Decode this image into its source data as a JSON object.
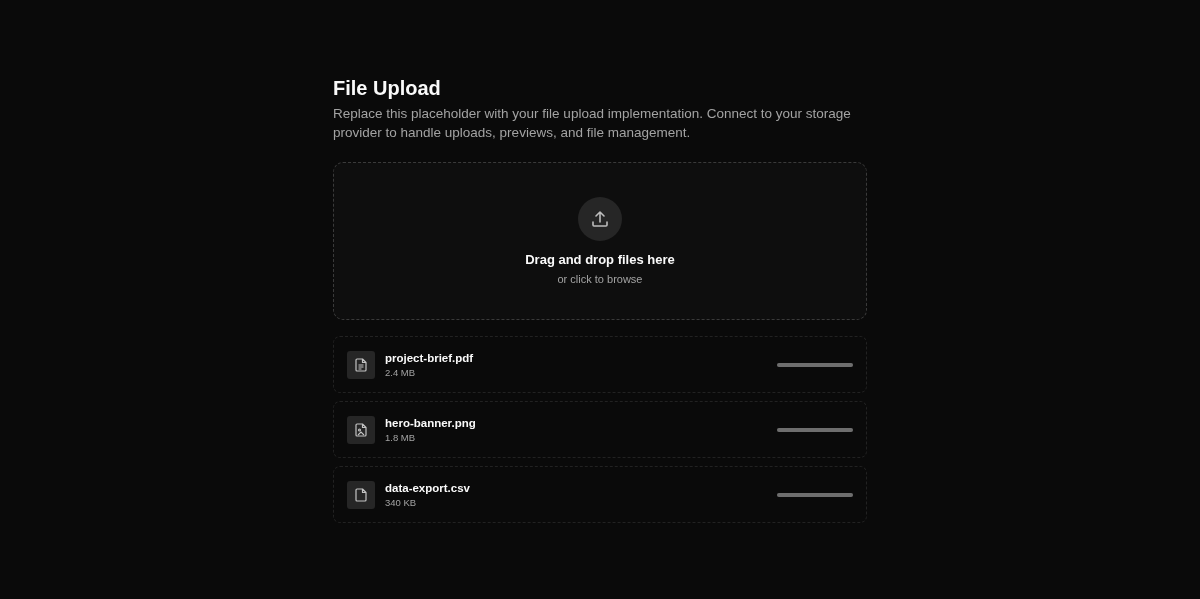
{
  "title": "File Upload",
  "description": "Replace this placeholder with your file upload implementation. Connect to your storage provider to handle uploads, previews, and file management.",
  "dropzone": {
    "heading": "Drag and drop files here",
    "hint": "or click to browse"
  },
  "files": [
    {
      "kind": "document",
      "name": "project-brief.pdf",
      "size": "2.4 MB",
      "level": 1
    },
    {
      "kind": "image",
      "name": "hero-banner.png",
      "size": "1.8 MB",
      "level": 1
    },
    {
      "kind": "file",
      "name": "data-export.csv",
      "size": "340 KB",
      "level": 1
    }
  ]
}
